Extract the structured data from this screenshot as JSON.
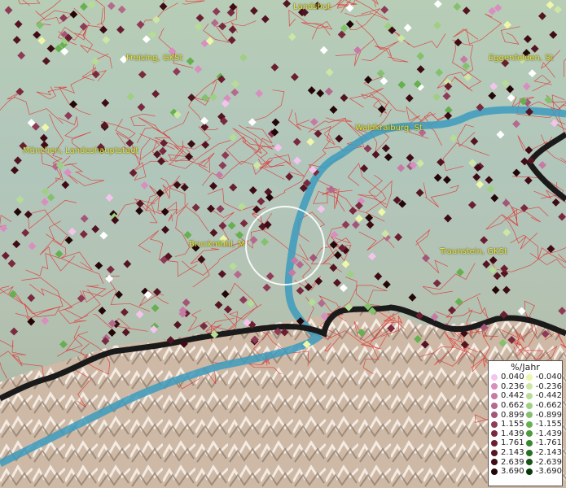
{
  "map": {
    "places": [
      {
        "name": "Landshut"
      },
      {
        "name": "Freising, GKSt"
      },
      {
        "name": "Eggenfelden, St"
      },
      {
        "name": "München, Landeshauptstadt"
      },
      {
        "name": "Waldkraiburg, St"
      },
      {
        "name": "Bruckmühl, M"
      },
      {
        "name": "Traunstein, GKSt"
      }
    ],
    "colors": {
      "positive": [
        "#f4c4ec",
        "#d88fc0",
        "#c77aa6",
        "#b36a8d",
        "#a35678",
        "#8e3b58",
        "#7a2a3f",
        "#6a1f30",
        "#541522",
        "#3f0c15",
        "#240609"
      ],
      "negative": [
        "#eef7a8",
        "#cde6a4",
        "#b6dc96",
        "#9fcf84",
        "#84c16d",
        "#66b050",
        "#4c9a3c",
        "#3a8630",
        "#256f22",
        "#155712",
        "#083a08"
      ],
      "border_line": "#1a1a1a",
      "river": "#3c9bbd",
      "district_lines": "#e03434"
    }
  },
  "legend": {
    "title": "%/Jahr",
    "positive": [
      "0.040",
      "0.236",
      "0.442",
      "0.662",
      "0.899",
      "1.155",
      "1.439",
      "1.761",
      "2.143",
      "2.639",
      "3.690"
    ],
    "negative": [
      "-0.040",
      "-0.236",
      "-0.442",
      "-0.662",
      "-0.899",
      "-1.155",
      "-1.439",
      "-1.761",
      "-2.143",
      "-2.639",
      "-3.690"
    ]
  }
}
